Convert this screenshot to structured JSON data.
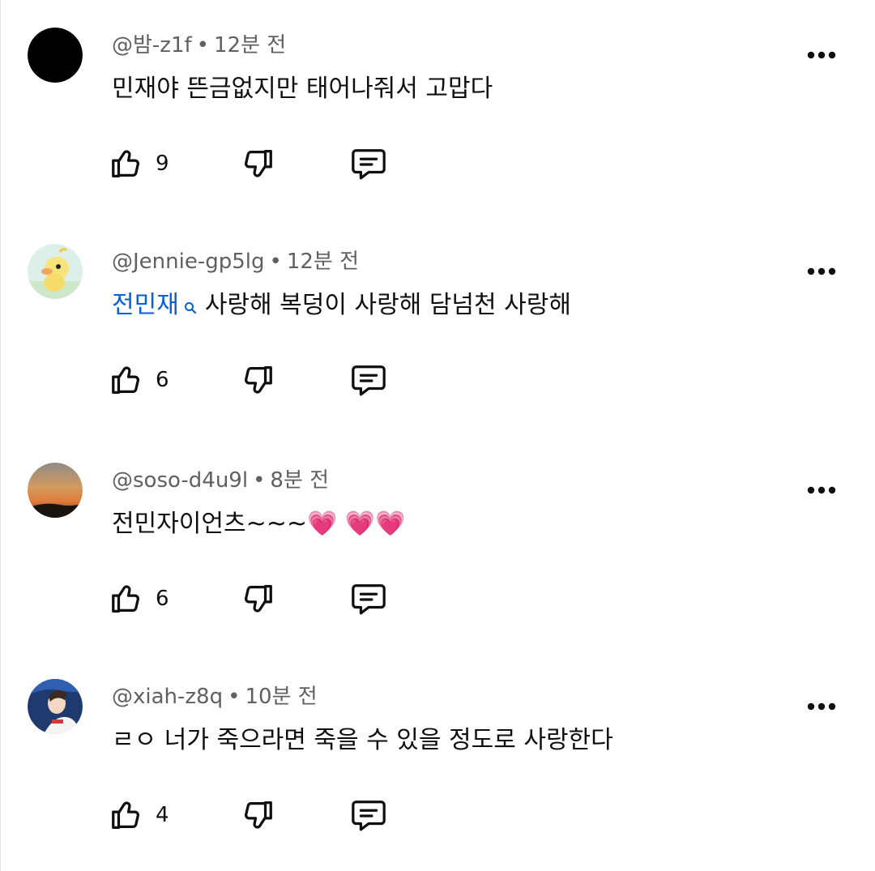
{
  "comments": [
    {
      "handle": "@밤-z1f",
      "time": "12분 전",
      "text": "민재야 뜬금없지만 태어나줘서 고맙다",
      "likes": "9",
      "avatar": "black-circle"
    },
    {
      "handle": "@Jennie-gp5lg",
      "time": "12분 전",
      "mention": "전민재",
      "text": "사랑해 복덩이 사랑해 담넘천 사랑해",
      "likes": "6",
      "avatar": "yellow-duck"
    },
    {
      "handle": "@soso-d4u9l",
      "time": "8분 전",
      "text": "전민자이언츠~~~💗 💗💗",
      "likes": "6",
      "avatar": "sunset-sky"
    },
    {
      "handle": "@xiah-z8q",
      "time": "10분 전",
      "text": "ㄹㅇ 너가 죽으라면 죽을 수 있을 정도로 사랑한다",
      "likes": "4",
      "avatar": "person-photo"
    }
  ],
  "separator": "•",
  "icons": {
    "like": "thumbs-up-icon",
    "dislike": "thumbs-down-icon",
    "reply": "comment-icon",
    "more": "more-vertical-dots-icon",
    "mention": "search-icon"
  },
  "colors": {
    "text": "#0f0f0f",
    "meta": "#606060",
    "mention": "#065fd4",
    "background": "#ffffff"
  }
}
